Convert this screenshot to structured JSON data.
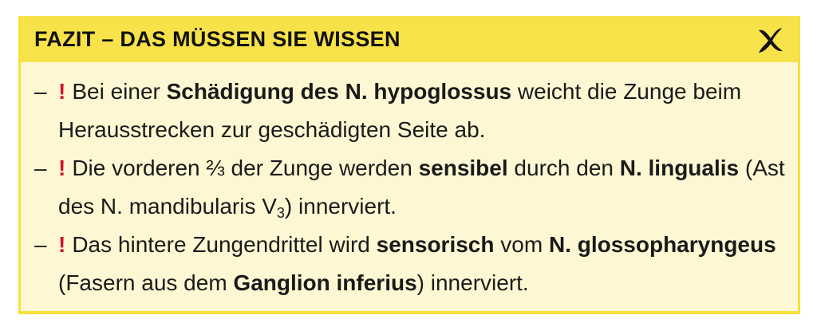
{
  "box": {
    "title": "FAZIT – DAS MÜSSEN SIE WISSEN",
    "icon": "tick-cross-icon",
    "colors": {
      "header": "#f7e24a",
      "background": "#fdf8d3",
      "border": "#f7df3c",
      "exclamation": "#d4102a"
    }
  },
  "items": [
    {
      "dash": "–",
      "mark": "!",
      "p1": "Bei einer ",
      "b1": "Schädigung des N. hypoglossus",
      "p2": " weicht die Zunge beim Herausstrecken zur geschädigten Seite ab."
    },
    {
      "dash": "–",
      "mark": "!",
      "p1": "Die vorderen ⅔ der Zunge werden ",
      "b1": "sensibel",
      "p2": " durch den ",
      "b2": "N. lin­gualis",
      "p3": " (Ast des N. mandibularis V",
      "sub": "3",
      "p4": ") innerviert."
    },
    {
      "dash": "–",
      "mark": "!",
      "p1": "Das hintere Zungendrittel wird ",
      "b1": "sensorisch",
      "p2": " vom ",
      "b2": "N. glossopha­ryngeus",
      "p3": " (Fasern aus dem ",
      "b3": "Ganglion inferius",
      "p4": ") innerviert."
    }
  ]
}
